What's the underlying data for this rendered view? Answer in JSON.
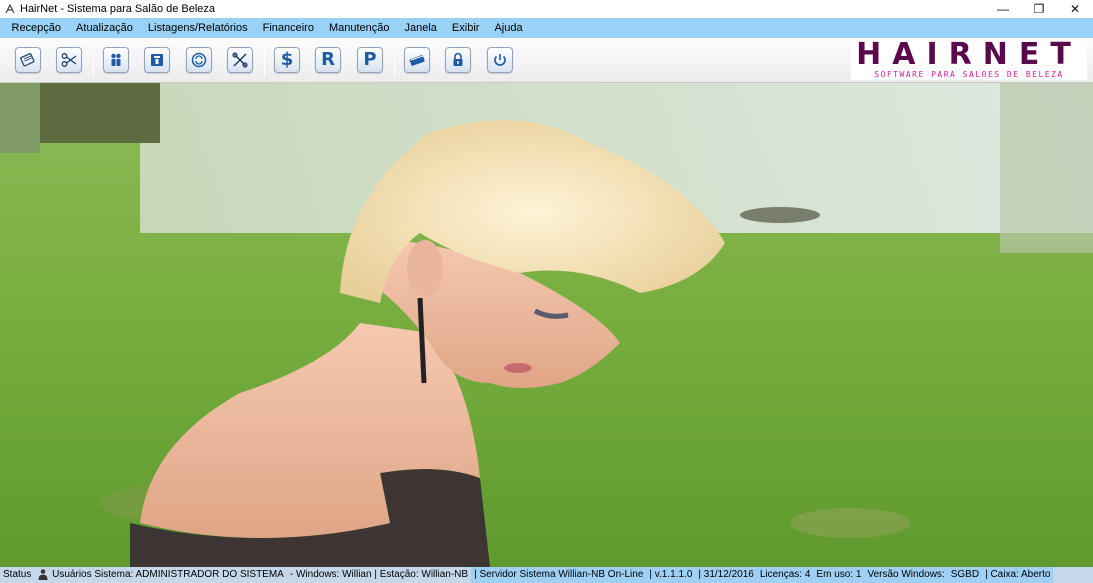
{
  "window": {
    "title": "HairNet - Sistema para Salão de Beleza",
    "controls": {
      "minimize": "—",
      "restore": "❐",
      "close": "✕"
    }
  },
  "menu": {
    "items": [
      "Recepção",
      "Atualização",
      "Listagens/Relatórios",
      "Financeiro",
      "Manutenção",
      "Janela",
      "Exibir",
      "Ajuda"
    ]
  },
  "toolbar": {
    "letters": {
      "dollar": "$",
      "r": "R",
      "p": "P"
    }
  },
  "logo": {
    "main": "HAIRNET",
    "sub": "SOFTWARE PARA SALOES DE BELEZA"
  },
  "status": {
    "label": "Status",
    "users": "Usuários Sistema: ADMINISTRADOR DO SISTEMA",
    "windows": "- Windows: Willian | Estação: Willian-NB",
    "server": "| Servidor Sistema Willian-NB On-Line",
    "version": "| v.1.1.1.0",
    "date": "| 31/12/2016",
    "licenses": "Licenças: 4",
    "in_use": "Em uso: 1",
    "windows_version": "Versão Windows:",
    "sgbd": "SGBD",
    "cash": "| Caixa: Aberto"
  },
  "colors": {
    "menubar": "#99d1f7",
    "statusbar": "#c5d8ea",
    "logo_dark": "#5a0a4a",
    "logo_pink": "#d81b9a"
  }
}
